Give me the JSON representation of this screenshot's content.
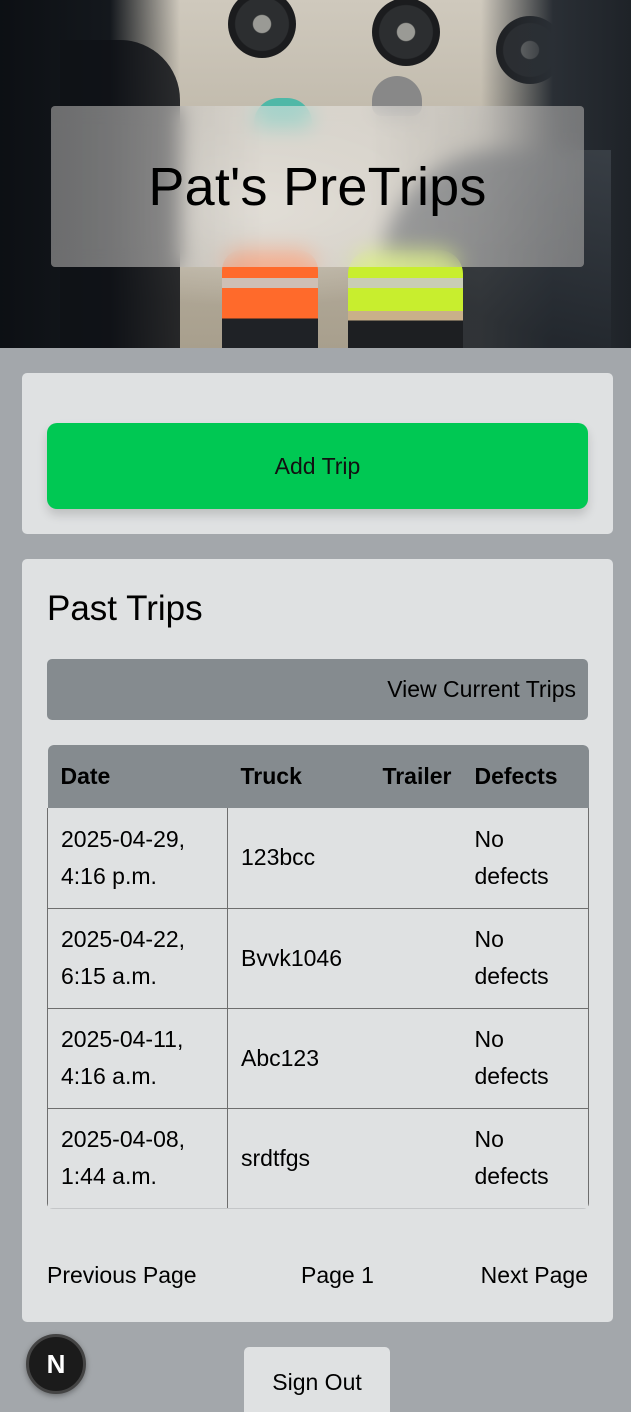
{
  "app": {
    "title": "Pat's PreTrips"
  },
  "actions": {
    "add_trip": "Add Trip"
  },
  "past_trips": {
    "heading": "Past Trips",
    "view_current": "View Current Trips",
    "columns": {
      "date": "Date",
      "truck": "Truck",
      "trailer": "Trailer",
      "defects": "Defects"
    },
    "rows": [
      {
        "date_line1": "2025-04-29,",
        "date_line2": "4:16 p.m.",
        "truck": "123bcc",
        "trailer": "",
        "defects_line1": "No",
        "defects_line2": "defects"
      },
      {
        "date_line1": "2025-04-22,",
        "date_line2": "6:15 a.m.",
        "truck": "Bvvk1046",
        "trailer": "",
        "defects_line1": "No",
        "defects_line2": "defects"
      },
      {
        "date_line1": "2025-04-11,",
        "date_line2": "4:16 a.m.",
        "truck": "Abc123",
        "trailer": "",
        "defects_line1": "No",
        "defects_line2": "defects"
      },
      {
        "date_line1": "2025-04-08,",
        "date_line2": "1:44 a.m.",
        "truck": "srdtfgs",
        "trailer": "",
        "defects_line1": "No",
        "defects_line2": "defects"
      }
    ],
    "pagination": {
      "previous": "Previous Page",
      "current": "Page 1",
      "next": "Next Page"
    }
  },
  "footer": {
    "sign_out": "Sign Out",
    "dev_badge": "N"
  },
  "colors": {
    "page_bg": "#a3a7ab",
    "card_bg": "#dfe1e2",
    "primary_button": "#00c853",
    "secondary_button": "#858b8f"
  }
}
